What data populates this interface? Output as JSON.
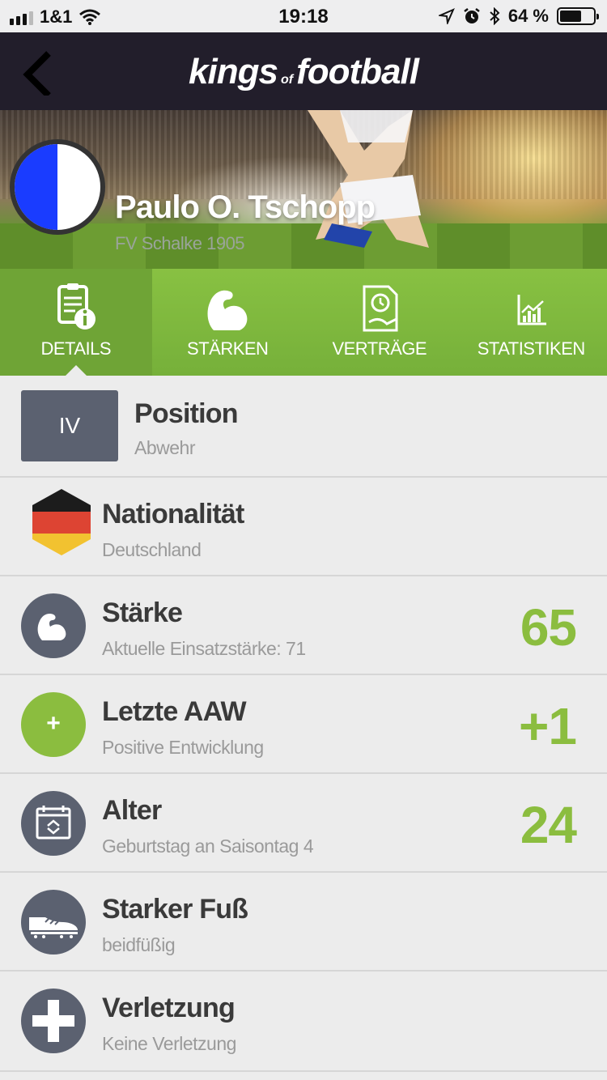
{
  "status_bar": {
    "carrier": "1&1",
    "time": "19:18",
    "battery": "64 %",
    "battery_level": 0.64,
    "icons": [
      "signal-icon",
      "wifi-icon",
      "location-icon",
      "alarm-icon",
      "bluetooth-icon",
      "battery-icon"
    ]
  },
  "header": {
    "logo_main_1": "kings",
    "logo_small": "of",
    "logo_main_2": "football",
    "back_icon": "chevron-left-icon"
  },
  "player": {
    "name": "Paulo O. Tschopp",
    "club": "FV Schalke 1905",
    "club_colors": [
      "#1a3cff",
      "#ffffff"
    ]
  },
  "tabs": [
    {
      "label": "DETAILS",
      "icon": "details-icon",
      "active": true
    },
    {
      "label": "STÄRKEN",
      "icon": "muscle-icon",
      "active": false
    },
    {
      "label": "VERTRÄGE",
      "icon": "contract-icon",
      "active": false
    },
    {
      "label": "STATISTIKEN",
      "icon": "statistics-icon",
      "active": false
    }
  ],
  "details": {
    "position": {
      "badge": "IV",
      "title": "Position",
      "sub": "Abwehr"
    },
    "nationality": {
      "title": "Nationalität",
      "sub": "Deutschland",
      "icon": "germany-flag-icon"
    },
    "strength": {
      "title": "Stärke",
      "sub": "Aktuelle Einsatzstärke: 71",
      "value": "65",
      "icon": "muscle-icon"
    },
    "last_aaw": {
      "title": "Letzte AAW",
      "sub": "Positive Entwicklung",
      "value": "+1",
      "icon_text": "+",
      "icon": "plus-icon"
    },
    "age": {
      "title": "Alter",
      "sub": "Geburtstag an Saisontag 4",
      "value": "24",
      "icon": "calendar-icon"
    },
    "foot": {
      "title": "Starker Fuß",
      "sub": "beidfüßig",
      "icon": "football-boot-icon"
    },
    "injury": {
      "title": "Verletzung",
      "sub": "Keine Verletzung",
      "icon": "medical-cross-icon"
    }
  },
  "colors": {
    "accent_green": "#8bbd3f",
    "nav_bg": "#221e2b",
    "icon_bg": "#5b6170"
  }
}
